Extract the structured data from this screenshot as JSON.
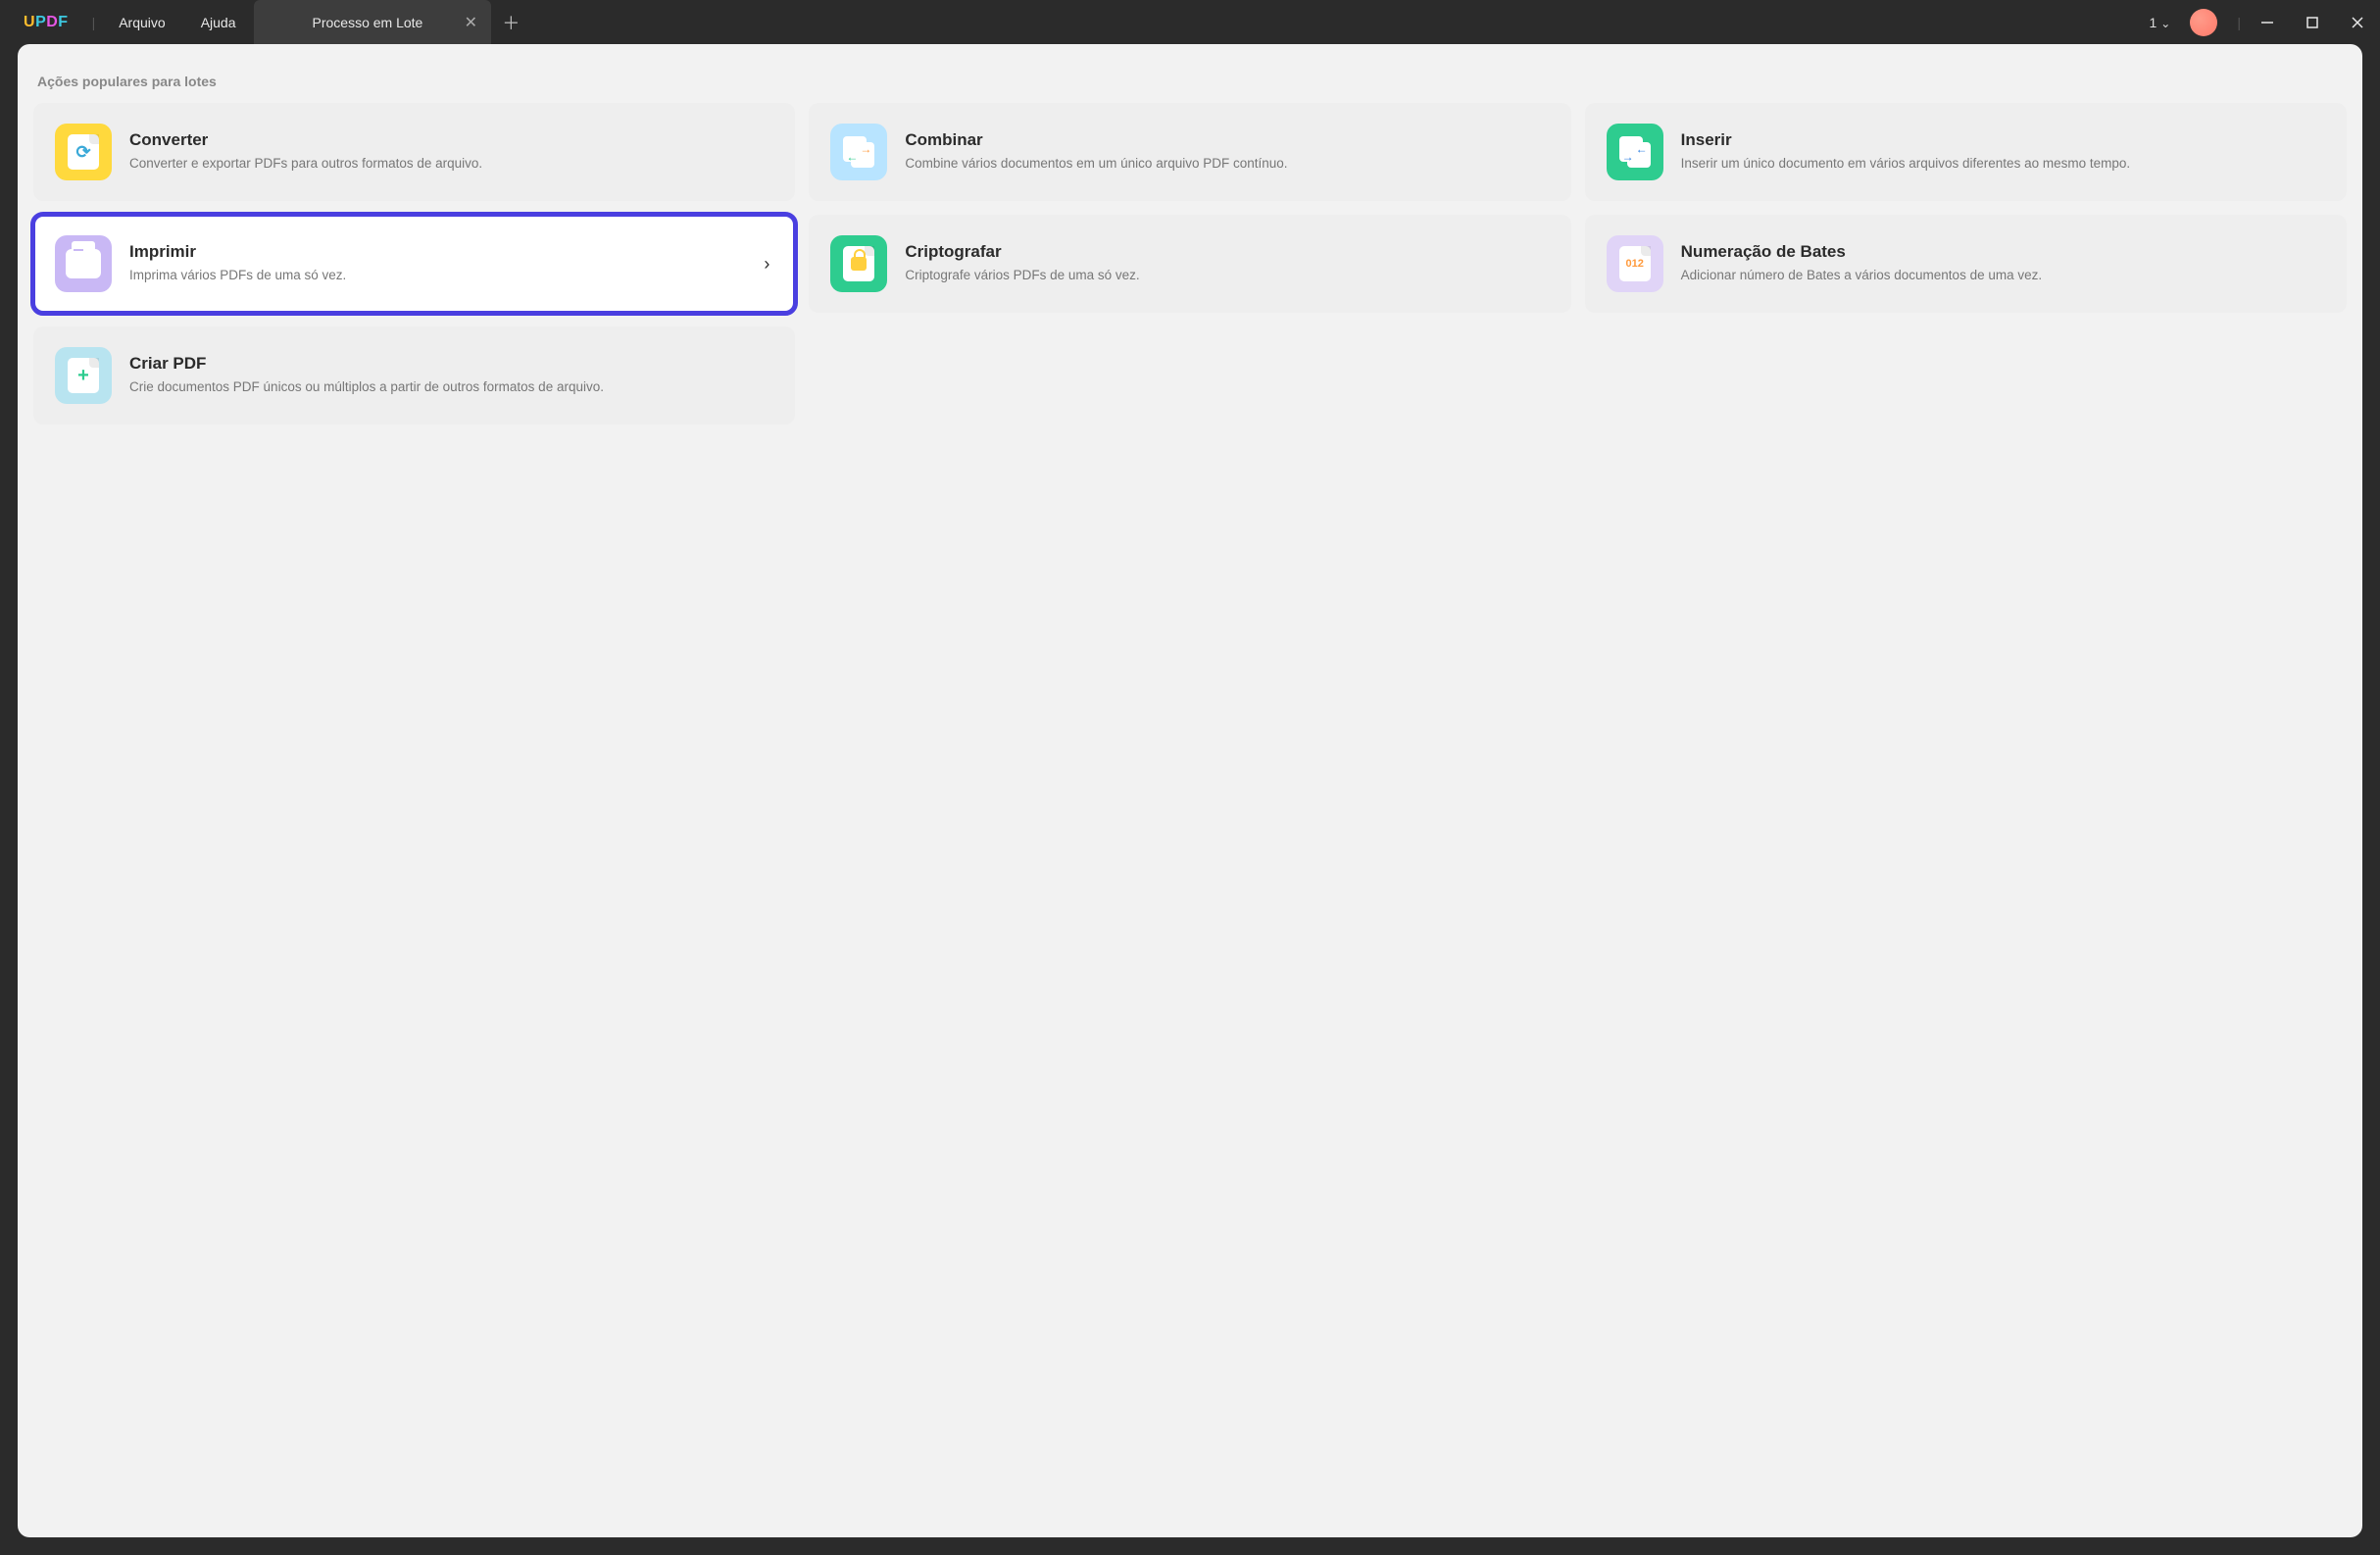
{
  "app": {
    "logo": "UPDF"
  },
  "menu": {
    "file": "Arquivo",
    "help": "Ajuda"
  },
  "tab": {
    "title": "Processo em Lote"
  },
  "window": {
    "count": "1"
  },
  "section": {
    "title": "Ações populares para lotes"
  },
  "cards": {
    "convert": {
      "title": "Converter",
      "desc": "Converter e exportar PDFs para outros formatos de arquivo."
    },
    "combine": {
      "title": "Combinar",
      "desc": "Combine vários documentos em um único arquivo PDF contínuo."
    },
    "insert": {
      "title": "Inserir",
      "desc": "Inserir um único documento em vários arquivos diferentes ao mesmo tempo."
    },
    "print": {
      "title": "Imprimir",
      "desc": "Imprima vários PDFs de uma só vez."
    },
    "encrypt": {
      "title": "Criptografar",
      "desc": "Criptografe vários PDFs de uma só vez."
    },
    "bates": {
      "title": "Numeração de Bates",
      "desc": "Adicionar número de Bates a vários documentos de uma vez."
    },
    "create": {
      "title": "Criar PDF",
      "desc": "Crie documentos PDF únicos ou múltiplos a partir de outros formatos de arquivo."
    }
  }
}
